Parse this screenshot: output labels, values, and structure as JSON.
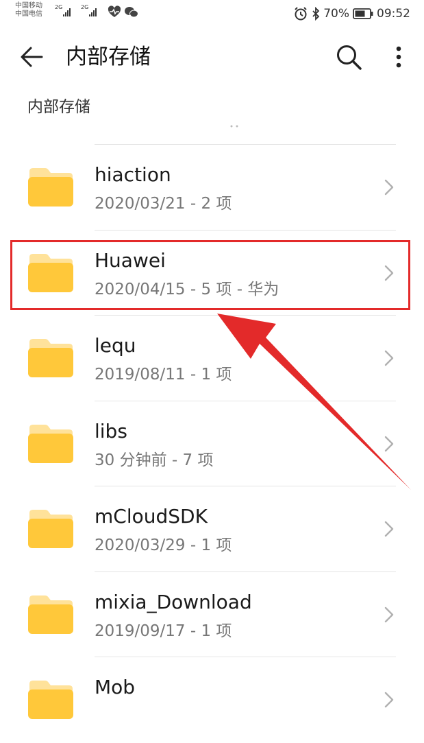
{
  "status_bar": {
    "carrier_1": "中国移动",
    "carrier_2": "中国电信",
    "signal_1": "2G",
    "signal_2": "2G",
    "battery": "70%",
    "time": "09:52"
  },
  "app_bar": {
    "title": "内部存储"
  },
  "breadcrumb": "内部存储",
  "files": [
    {
      "name": "hiaction",
      "meta": "2020/03/21 - 2 项"
    },
    {
      "name": "Huawei",
      "meta": "2020/04/15 - 5 项 - 华为"
    },
    {
      "name": "lequ",
      "meta": "2019/08/11 - 1 项"
    },
    {
      "name": "libs",
      "meta": "30 分钟前 - 7 项"
    },
    {
      "name": "mCloudSDK",
      "meta": "2020/03/29 - 1 项"
    },
    {
      "name": "mixia_Download",
      "meta": "2019/09/17 - 1 项"
    },
    {
      "name": "Mob",
      "meta": ""
    }
  ],
  "colors": {
    "folder": "#ffc83a",
    "folder_tab": "#ffe29a",
    "annotation": "#e32a2a"
  },
  "icons": {
    "back": "arrow-left-icon",
    "search": "search-icon",
    "more": "more-vertical-icon",
    "folder": "folder-icon",
    "chevron": "chevron-right-icon"
  }
}
